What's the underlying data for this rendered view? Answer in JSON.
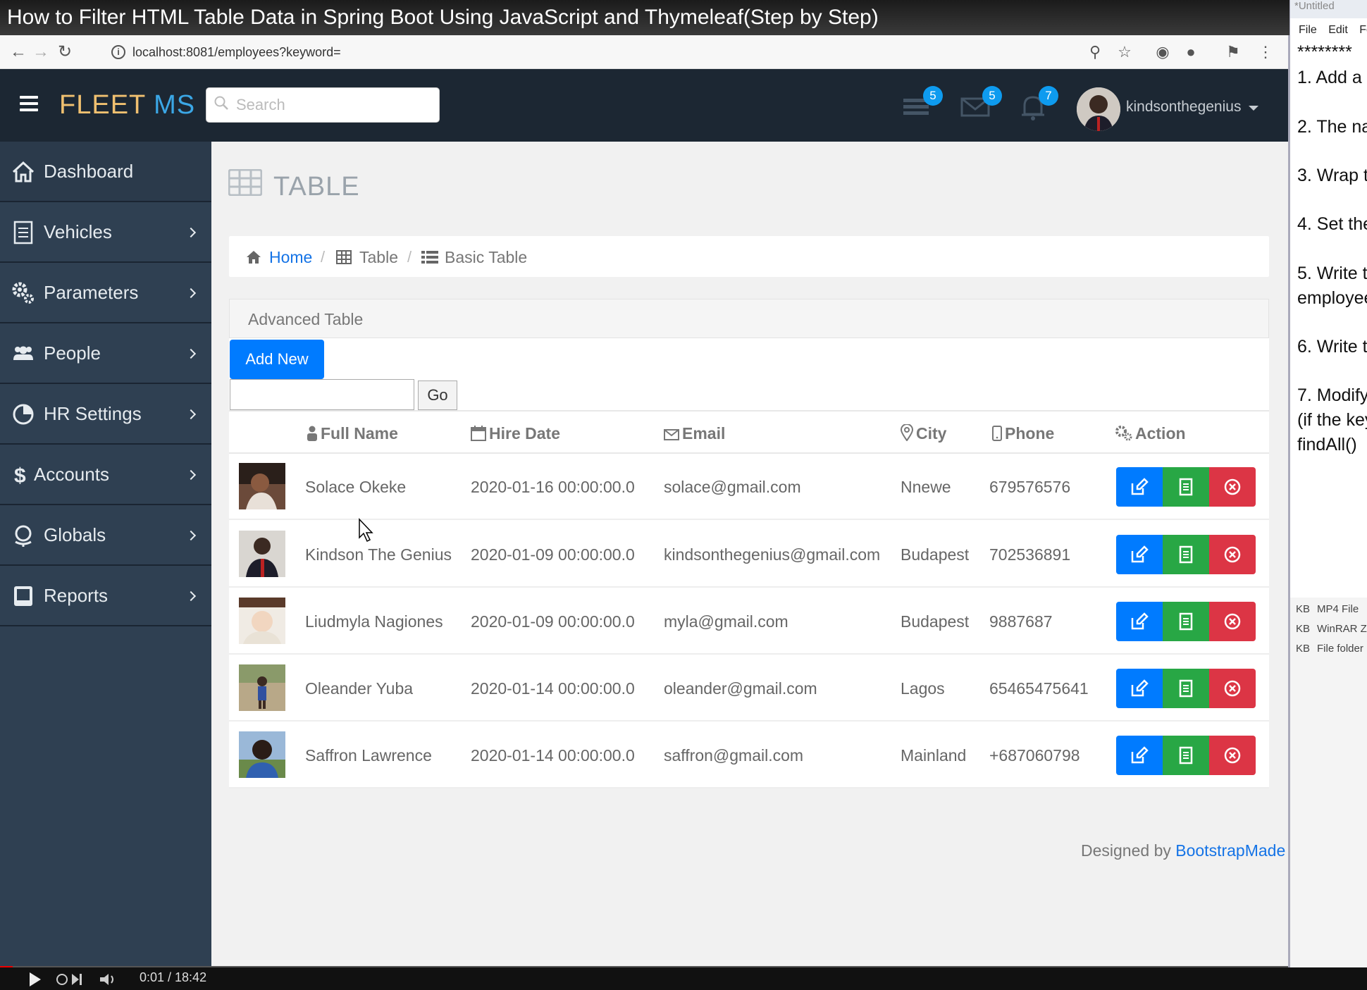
{
  "video": {
    "title": "How to Filter HTML Table Data in Spring Boot Using JavaScript and Thymeleaf(Step by Step)",
    "time": "0:01 / 18:42"
  },
  "browser": {
    "url": "localhost:8081/employees?keyword="
  },
  "header": {
    "brand_part1": "FLEET",
    "brand_part2": "MS",
    "search_placeholder": "Search",
    "badges": {
      "tasks": "5",
      "messages": "5",
      "notifications": "7"
    },
    "username": "kindsonthegenius"
  },
  "sidebar": {
    "items": [
      {
        "label": "Dashboard",
        "icon": "home-icon"
      },
      {
        "label": "Vehicles",
        "icon": "document-icon"
      },
      {
        "label": "Parameters",
        "icon": "gears-icon"
      },
      {
        "label": "People",
        "icon": "users-icon"
      },
      {
        "label": "HR Settings",
        "icon": "pie-chart-icon"
      },
      {
        "label": "Accounts",
        "icon": "dollar-icon"
      },
      {
        "label": "Globals",
        "icon": "globe-icon"
      },
      {
        "label": "Reports",
        "icon": "book-icon"
      }
    ]
  },
  "page": {
    "title": "TABLE",
    "breadcrumb": {
      "home": "Home",
      "table": "Table",
      "basic": "Basic Table"
    },
    "panel_title": "Advanced Table",
    "add_button": "Add New",
    "go_button": "Go",
    "filter_value": ""
  },
  "table": {
    "columns": [
      "Full Name",
      "Hire Date",
      "Email",
      "City",
      "Phone",
      "Action"
    ],
    "rows": [
      {
        "name": "Solace Okeke",
        "hire_date": "2020-01-16 00:00:00.0",
        "email": "solace@gmail.com",
        "city": "Nnewe",
        "phone": "679576576"
      },
      {
        "name": "Kindson The Genius",
        "hire_date": "2020-01-09 00:00:00.0",
        "email": "kindsonthegenius@gmail.com",
        "city": "Budapest",
        "phone": "702536891"
      },
      {
        "name": "Liudmyla Nagiones",
        "hire_date": "2020-01-09 00:00:00.0",
        "email": "myla@gmail.com",
        "city": "Budapest",
        "phone": "9887687"
      },
      {
        "name": "Oleander Yuba",
        "hire_date": "2020-01-14 00:00:00.0",
        "email": "oleander@gmail.com",
        "city": "Lagos",
        "phone": "65465475641"
      },
      {
        "name": "Saffron Lawrence",
        "hire_date": "2020-01-14 00:00:00.0",
        "email": "saffron@gmail.com",
        "city": "Mainland",
        "phone": "+687060798"
      }
    ]
  },
  "footer": {
    "prefix": "Designed by",
    "link": "BootstrapMade"
  },
  "editor": {
    "title": "*Untitled",
    "menu": "File Edit Fo",
    "lines": [
      "********",
      "1. Add a",
      "2. The na",
      "3. Wrap t",
      "4. Set the",
      "5. Write t",
      "employee",
      "6. Write t",
      "7. Modify",
      "(if the key",
      "findAll()"
    ],
    "files": [
      {
        "size": "KB",
        "type": "MP4 File"
      },
      {
        "size": "KB",
        "type": "WinRAR ZIP"
      },
      {
        "size": "KB",
        "type": "File folder"
      }
    ]
  },
  "colors": {
    "header": "#1c2733",
    "sidebar": "#2f4052",
    "primary": "#007bff",
    "success": "#28a745",
    "danger": "#dc3545",
    "badge": "#0e9bef"
  }
}
